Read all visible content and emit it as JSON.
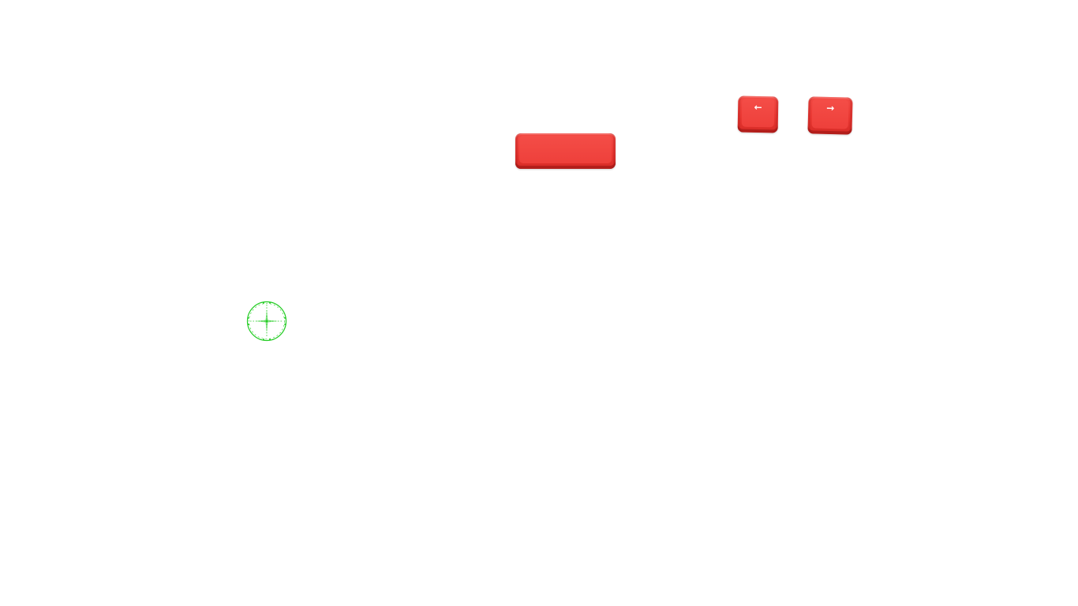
{
  "keys": {
    "spacebar": {
      "icon": "blank-keycap",
      "label": ""
    },
    "left_arrow": {
      "icon": "left-arrow-icon",
      "glyph": "←"
    },
    "right_arrow": {
      "icon": "right-arrow-icon",
      "glyph": "→"
    }
  },
  "crosshair": {
    "icon": "crosshair-reticle-icon"
  },
  "colors": {
    "keycap": "#ea3833",
    "keycap_shadow": "#b8221e",
    "reticle": "#22cc22",
    "background": "#ffffff"
  }
}
